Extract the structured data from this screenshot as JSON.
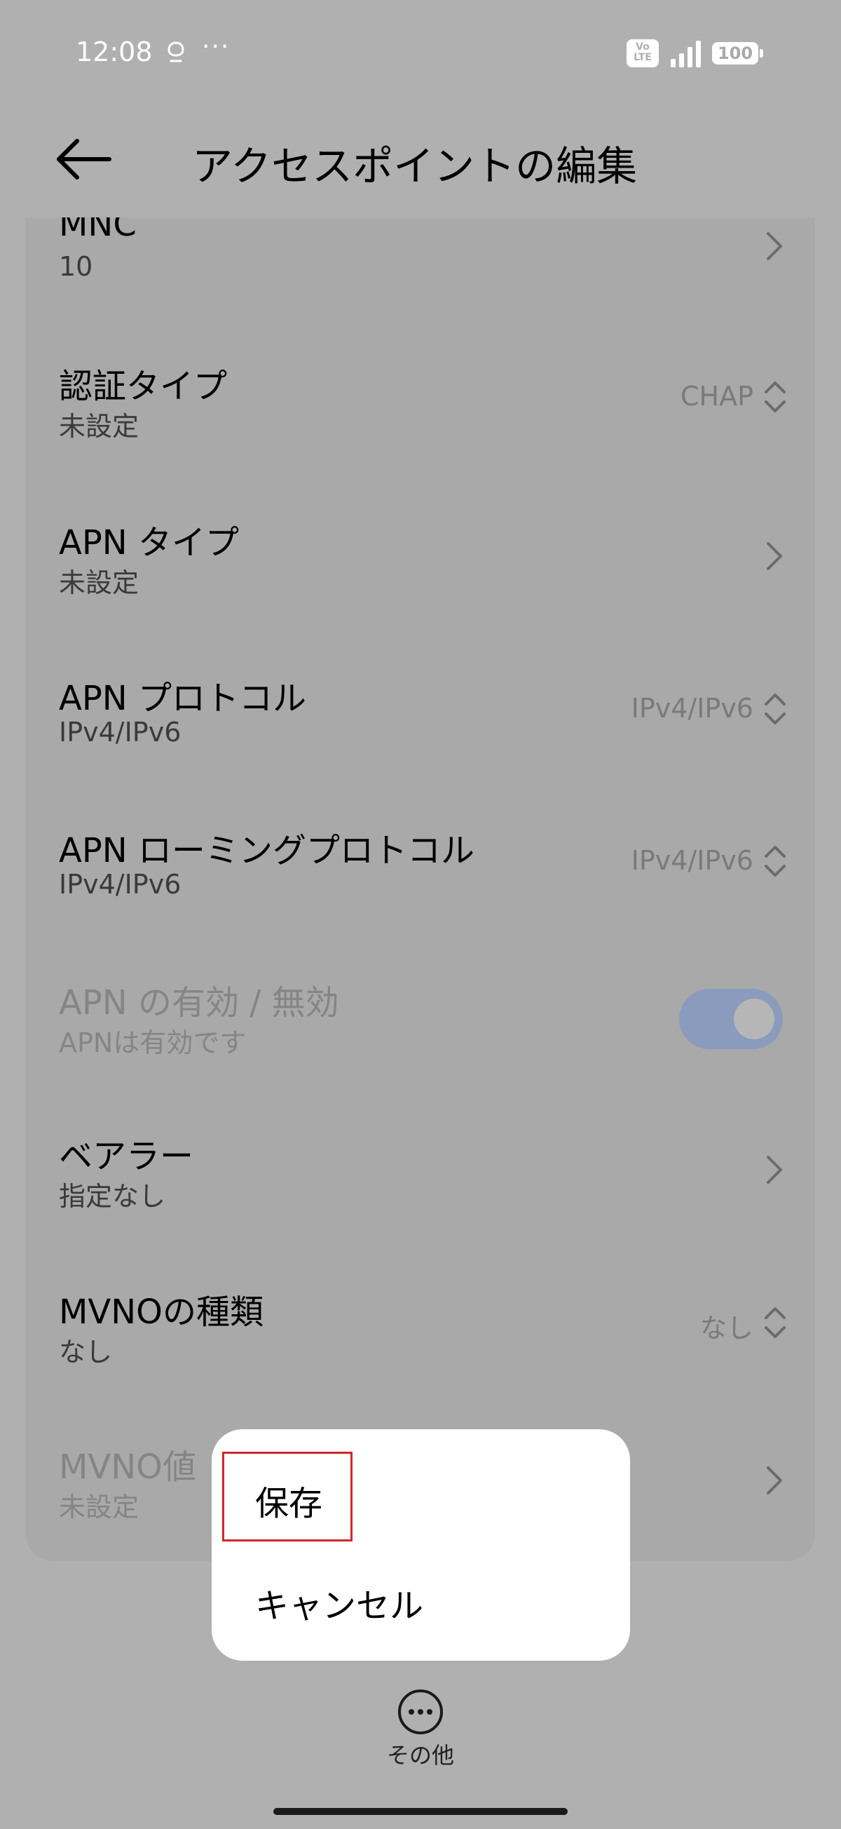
{
  "status_bar": {
    "time": "12:08",
    "more": "···",
    "volte_top": "Vo",
    "volte_bottom": "LTE",
    "battery": "100",
    "icons": [
      "notification-icon",
      "volte-icon",
      "signal-icon",
      "battery-icon"
    ]
  },
  "header": {
    "title": "アクセスポイントの編集",
    "back_icon": "arrow-left-icon"
  },
  "settings": [
    {
      "title": "MNC",
      "subtitle": "10",
      "control": "chevron-right"
    },
    {
      "title": "認証タイプ",
      "subtitle": "未設定",
      "value": "CHAP",
      "control": "updown"
    },
    {
      "title": "APN タイプ",
      "subtitle": "未設定",
      "control": "chevron-right"
    },
    {
      "title": "APN プロトコル",
      "subtitle": "IPv4/IPv6",
      "value": "IPv4/IPv6",
      "control": "updown"
    },
    {
      "title": "APN ローミングプロトコル",
      "subtitle": "IPv4/IPv6",
      "value": "IPv4/IPv6",
      "control": "updown"
    },
    {
      "title": "APN の有効 / 無効",
      "subtitle": "APNは有効です",
      "control": "toggle",
      "enabled": false,
      "checked": true
    },
    {
      "title": "ベアラー",
      "subtitle": "指定なし",
      "control": "chevron-right"
    },
    {
      "title": "MVNOの種類",
      "subtitle": "なし",
      "value": "なし",
      "control": "updown"
    },
    {
      "title": "MVNO値",
      "subtitle": "未設定",
      "control": "chevron-right",
      "enabled": false
    }
  ],
  "popup_menu": {
    "items": [
      {
        "label": "保存",
        "highlighted": true
      },
      {
        "label": "キャンセル"
      }
    ],
    "highlight_color": "#d0282a"
  },
  "bottom": {
    "more_label": "その他",
    "more_icon": "more-horizontal-circle-icon"
  },
  "colors": {
    "scrim_background": "#b0b0b0",
    "card_background": "#a9a9a9",
    "toggle_track": "#8a9bbd"
  }
}
